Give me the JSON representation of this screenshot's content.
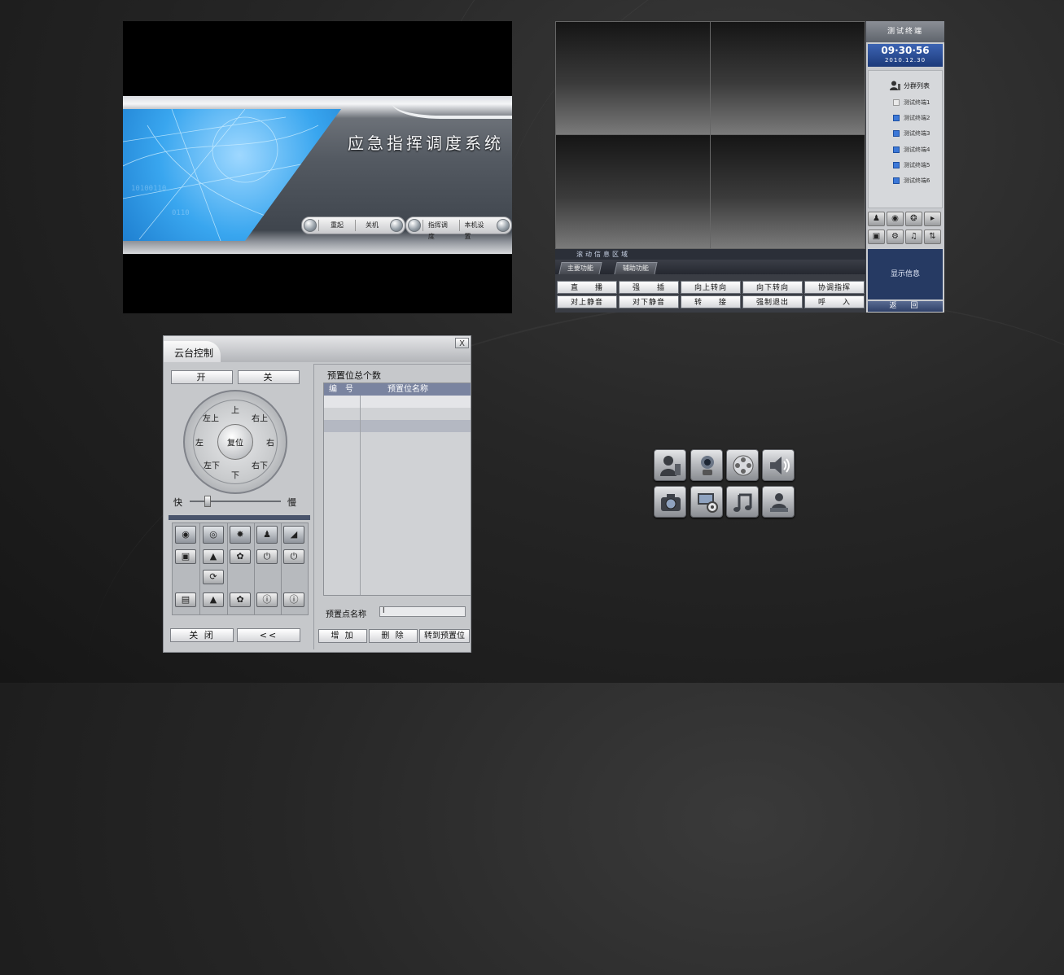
{
  "splash": {
    "title": "应急指挥调度系统",
    "buttons": [
      "重起",
      "关机",
      "指挥调度",
      "本机设置"
    ]
  },
  "console": {
    "terminal_title": "测试终端",
    "time": "09·30·56",
    "date": "2010.12.30",
    "group_list_title": "分群列表",
    "terminals": [
      "测试终端1",
      "测试终端2",
      "测试终端3",
      "测试终端4",
      "测试终端5",
      "测试终端6"
    ],
    "scroll_info": "滚动信息区域",
    "tabs": [
      "主要功能",
      "辅助功能"
    ],
    "function_buttons_row1": [
      "直　　播",
      "强　　插",
      "向上转向",
      "向下转向",
      "协调指挥"
    ],
    "function_buttons_row2": [
      "对上静音",
      "对下静音",
      "转　　接",
      "强制退出",
      "呼　　入"
    ],
    "display_info": "显示信息",
    "back": "返　回"
  },
  "ptz": {
    "title": "云台控制",
    "close_x": "X",
    "on": "开",
    "off": "关",
    "dial": {
      "up": "上",
      "down": "下",
      "left": "左",
      "right": "右",
      "up_left": "左上",
      "up_right": "右上",
      "down_left": "左下",
      "down_right": "右下",
      "reset": "复位"
    },
    "speed_fast": "快",
    "speed_slow": "慢",
    "close_button": "关 闭",
    "collapse_button": "<<",
    "preset_total_label": "预置位总个数",
    "table_headers": [
      "编　号",
      "预置位名称"
    ],
    "preset_name_label": "预置点名称",
    "preset_name_value": "l",
    "add_button": "增 加",
    "delete_button": "删 除",
    "goto_button": "转到预置位"
  },
  "icons": [
    "user-icon",
    "camera-robot-icon",
    "film-reel-icon",
    "speaker-icon",
    "photo-camera-icon",
    "settings-monitor-icon",
    "music-note-icon",
    "transfer-icon"
  ]
}
